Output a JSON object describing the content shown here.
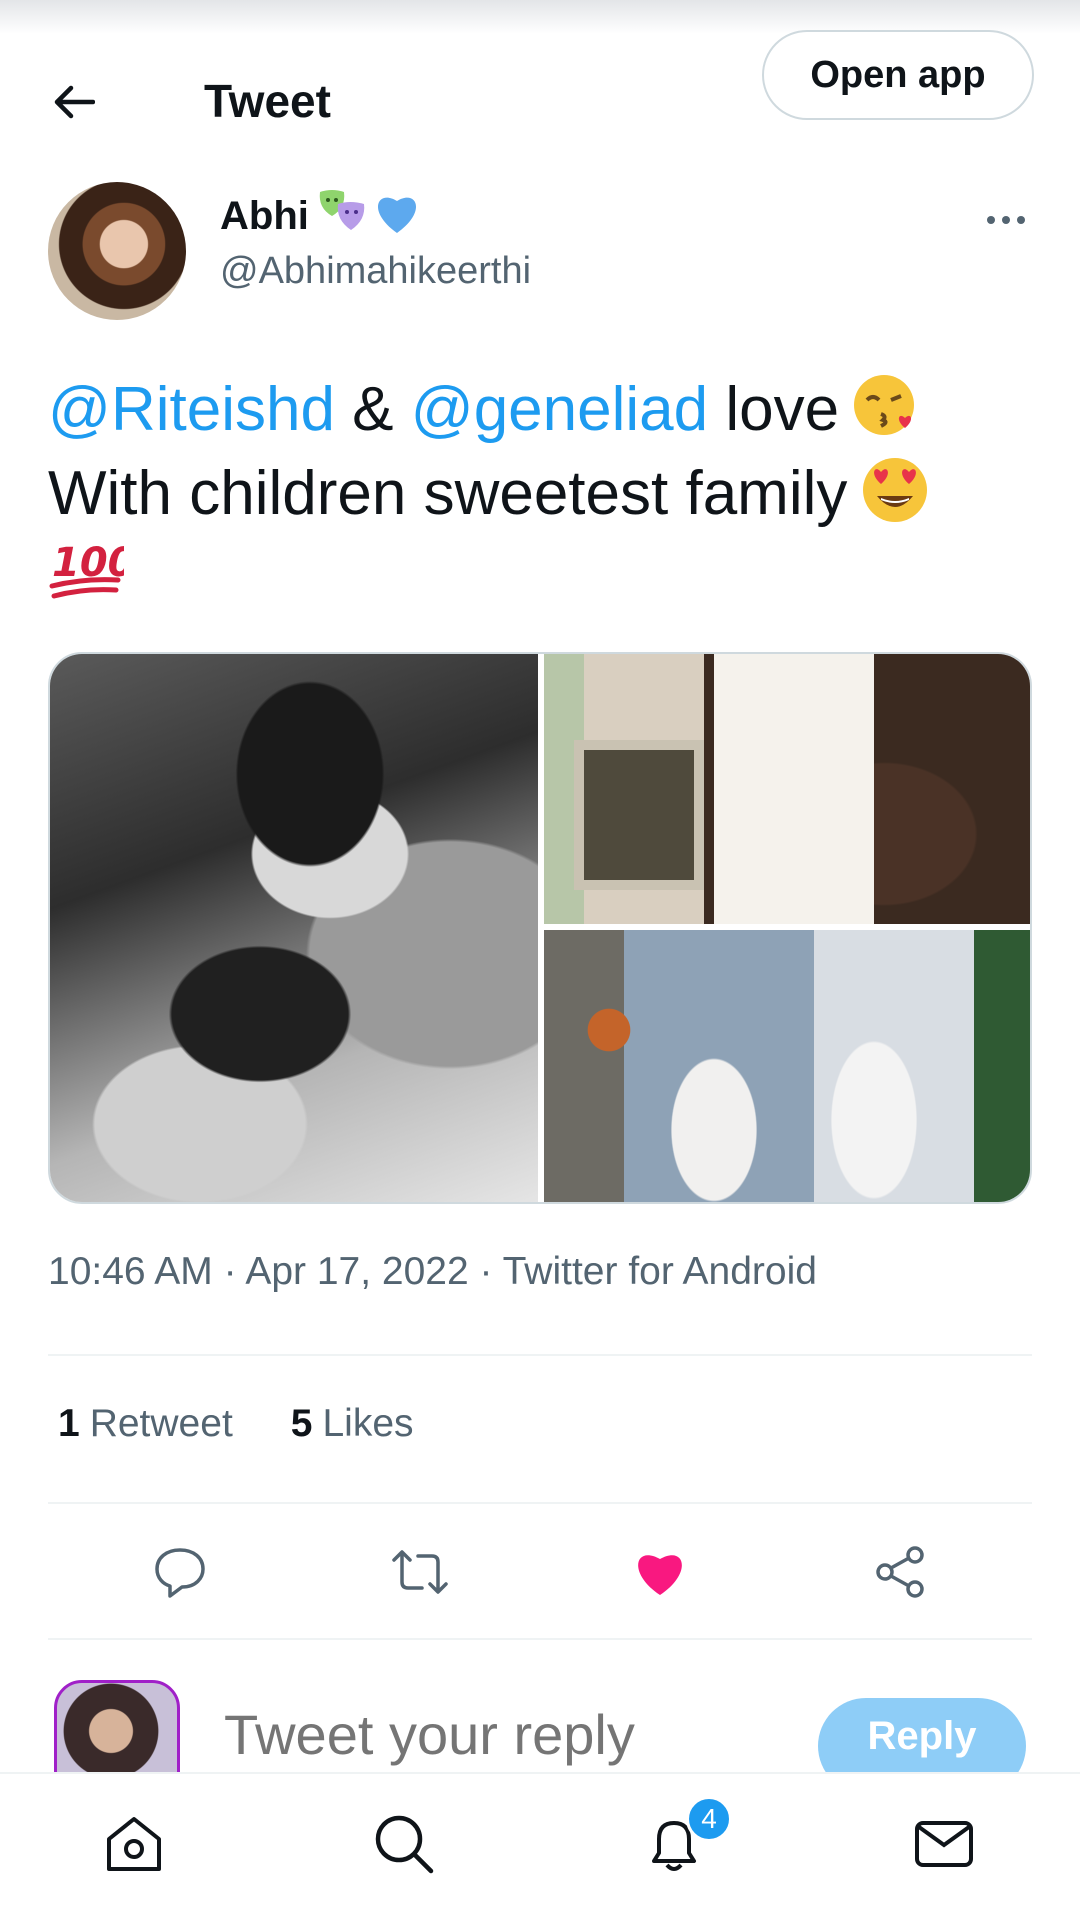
{
  "header": {
    "title": "Tweet",
    "open_app_label": "Open app"
  },
  "author": {
    "display_name": "Abhi",
    "handle": "@Abhimahikeerthi",
    "name_emojis": [
      "performing-arts-emoji",
      "blue-heart-emoji"
    ]
  },
  "tweet": {
    "mention_1": "@Riteishd",
    "amp": "&",
    "mention_2": "@geneliad",
    "text_1": "love",
    "text_2": "With children sweetest family",
    "emojis": [
      "kissing-face-emoji",
      "heart-eyes-emoji",
      "hundred-points-emoji"
    ]
  },
  "media": {
    "photos": [
      "photo-1",
      "photo-2",
      "photo-3"
    ]
  },
  "meta": {
    "time": "10:46 AM",
    "date": "Apr 17, 2022",
    "source": "Twitter for Android",
    "separator": "·"
  },
  "stats": {
    "retweets_count": "1",
    "retweets_label": "Retweet",
    "likes_count": "5",
    "likes_label": "Likes"
  },
  "actions": {
    "liked": true,
    "like_color": "#f91880",
    "icons": [
      "reply-icon",
      "retweet-icon",
      "like-icon",
      "share-icon"
    ]
  },
  "reply": {
    "placeholder": "Tweet your reply",
    "button_label": "Reply"
  },
  "bottom_nav": {
    "items": [
      "home-icon",
      "search-icon",
      "notifications-icon",
      "messages-icon"
    ],
    "notification_badge": "4"
  },
  "colors": {
    "accent": "#1d9bf0",
    "secondary_text": "#536471",
    "border": "#cfd9de"
  }
}
